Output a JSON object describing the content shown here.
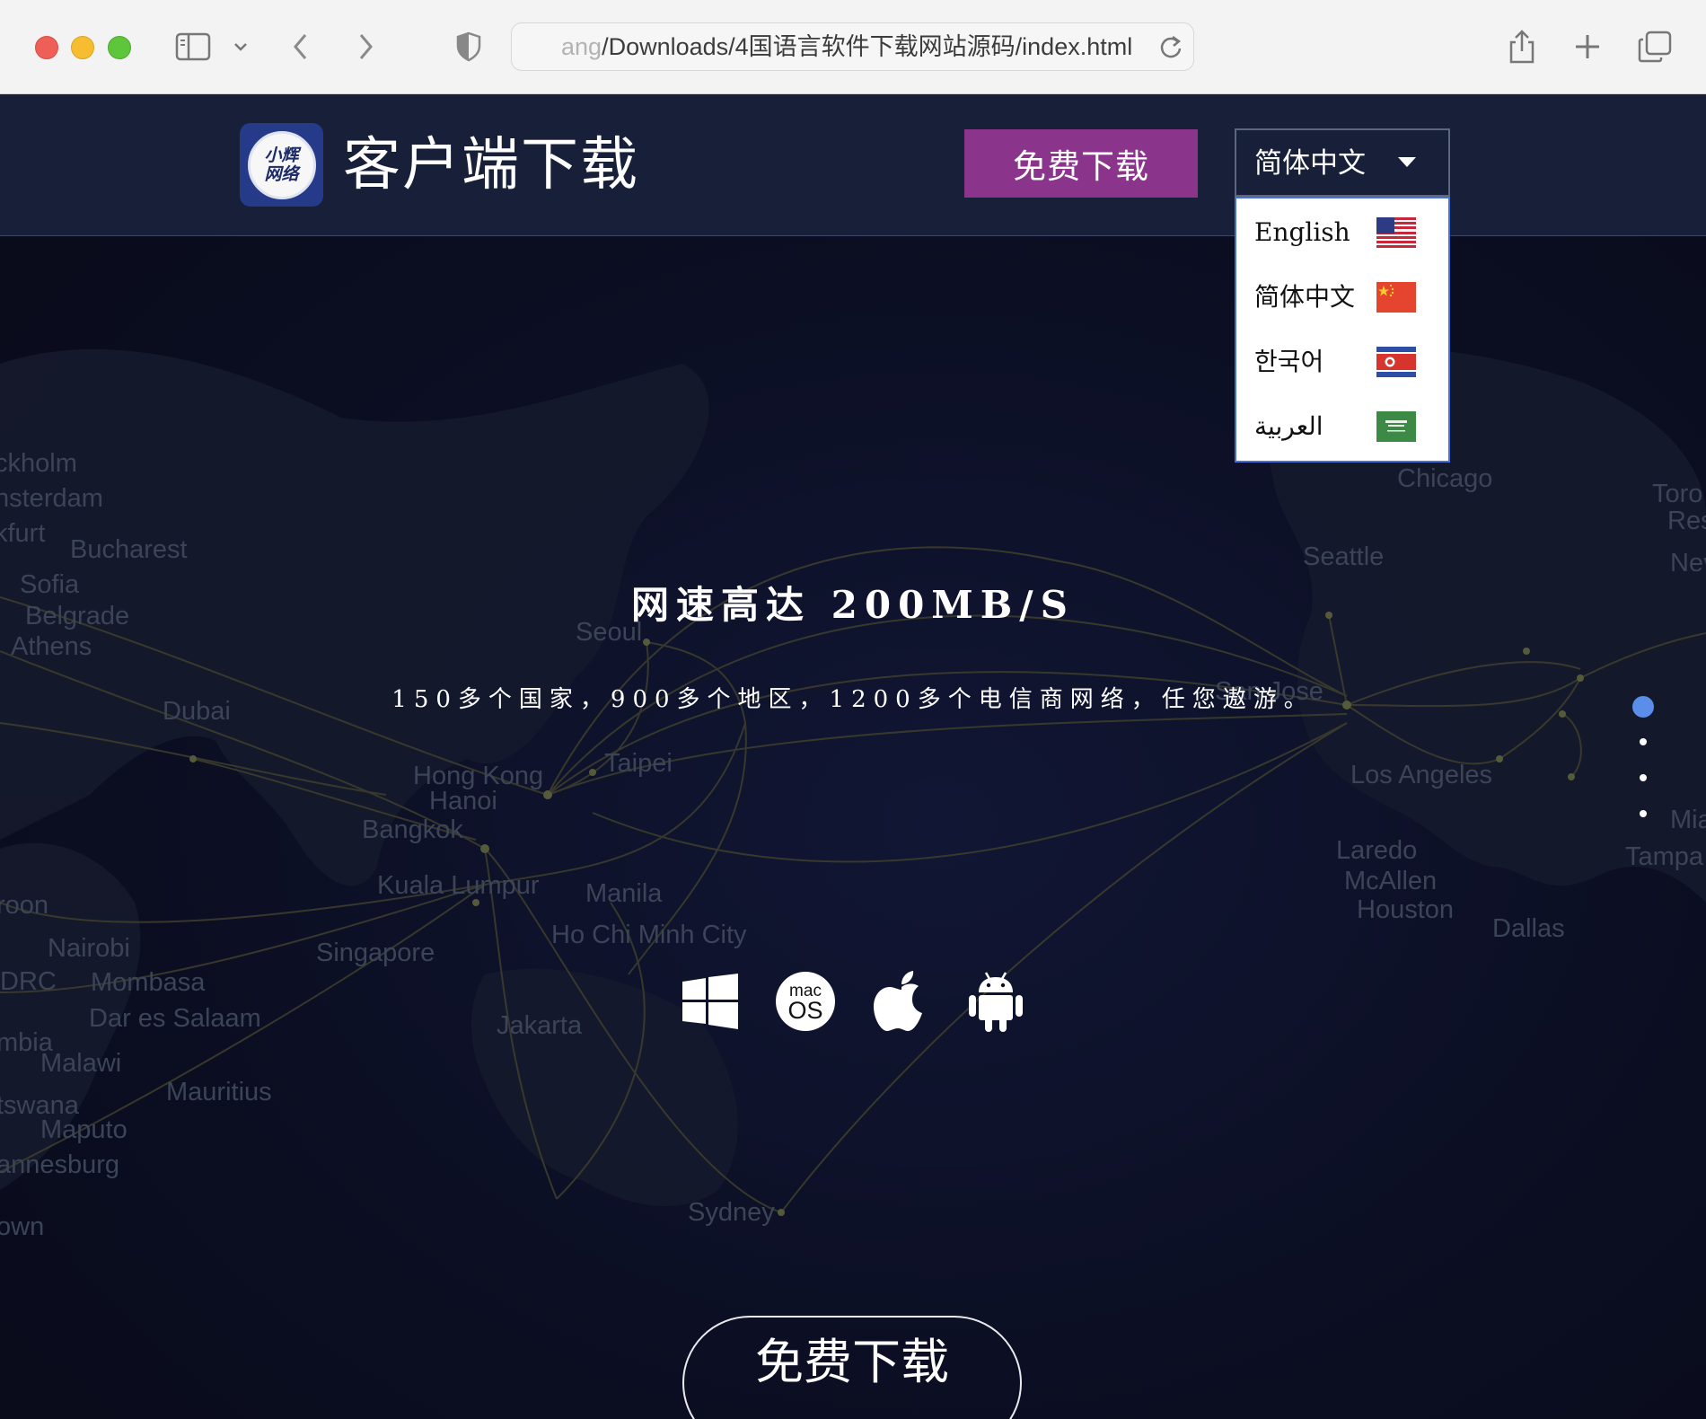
{
  "browser": {
    "url_faded": "ang",
    "url_main": "/Downloads/4国语言软件下载网站源码/index.html"
  },
  "header": {
    "logo_line1": "小辉",
    "logo_line2": "网络",
    "title": "客户端下载",
    "download_button": "免费下载",
    "language_selected": "简体中文"
  },
  "language_menu": [
    {
      "label": "English",
      "flag": "us-flag-icon"
    },
    {
      "label": "简体中文",
      "flag": "china-flag-icon"
    },
    {
      "label": "한국어",
      "flag": "north-korea-flag-icon"
    },
    {
      "label": "العربية",
      "flag": "saudi-flag-icon"
    }
  ],
  "hero": {
    "headline": "网速高达 200MB/S",
    "subtitle": "150多个国家，900多个地区，1200多个电信商网络，任您遨游。",
    "platforms": [
      "windows-icon",
      "macos-icon",
      "apple-icon",
      "android-icon"
    ],
    "cta_button": "免费下载"
  },
  "map_cities": [
    "ckholm",
    "nsterdam",
    "kfurt",
    "Bucharest",
    "Sofia",
    "Belgrade",
    "Athens",
    "Dubai",
    "Seoul",
    "Hong Kong",
    "Hanoi",
    "Bangkok",
    "Taipei",
    "Kuala Lumpur",
    "Manila",
    "Ho Chi Minh City",
    "Singapore",
    "Jakarta",
    "Nairobi",
    "DRC",
    "Mombasa",
    "Dar es Salaam",
    "mbia",
    "Malawi",
    "Mauritius",
    "tswana",
    "Maputo",
    "annesburg",
    "own",
    "Sydney",
    "Chicago",
    "Seattle",
    "San Jose",
    "Los Angeles",
    "Laredo",
    "McAllen",
    "Houston",
    "Dallas",
    "Toro",
    "Res",
    "Nev",
    "Mia",
    "Tampa",
    "roon"
  ],
  "pager": {
    "count": 4,
    "active": 0
  },
  "carousel": {
    "count": 3,
    "active": 2
  },
  "colors": {
    "header_bg": "#172038",
    "button_purple": "#8b348c",
    "page_bg": "#0b0e1f",
    "active_dot": "#5b8ee9"
  }
}
